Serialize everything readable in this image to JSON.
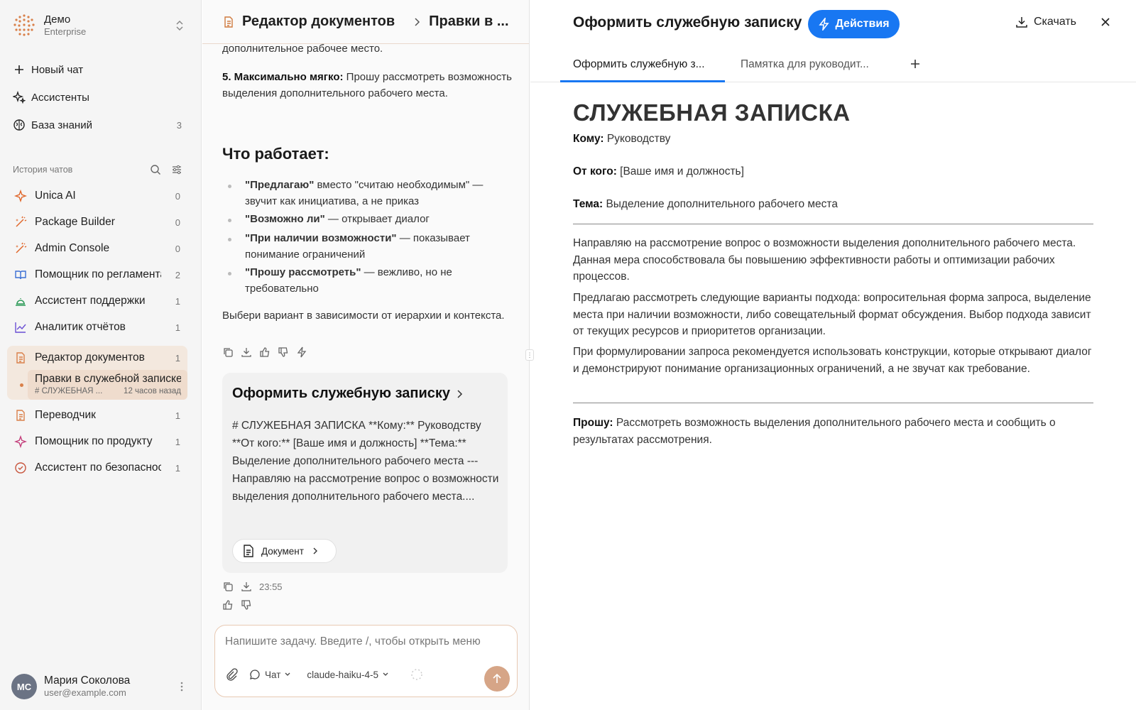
{
  "org": {
    "name": "Демо",
    "plan": "Enterprise"
  },
  "nav": [
    {
      "label": "Новый чат",
      "icon": "plus-icon",
      "count": ""
    },
    {
      "label": "Ассистенты",
      "icon": "sparkles-icon",
      "count": ""
    },
    {
      "label": "База знаний",
      "icon": "brain-icon",
      "count": "3"
    }
  ],
  "history": {
    "label": "История чатов",
    "chats": [
      {
        "label": "Unica AI",
        "count": "0",
        "icon": "sparkle-icon"
      },
      {
        "label": "Package Builder",
        "count": "0",
        "icon": "wand-icon"
      },
      {
        "label": "Admin Console",
        "count": "0",
        "icon": "wand-icon"
      },
      {
        "label": "Помощник по регламентам",
        "count": "2",
        "icon": "book-icon"
      },
      {
        "label": "Ассистент поддержки",
        "count": "1",
        "icon": "bell-icon"
      },
      {
        "label": "Аналитик отчётов",
        "count": "1",
        "icon": "chart-icon"
      },
      {
        "label": "Редактор документов",
        "count": "1",
        "icon": "document-icon"
      },
      {
        "label": "Переводчик",
        "count": "1",
        "icon": "document-icon"
      },
      {
        "label": "Помощник по продукту",
        "count": "1",
        "icon": "sparkle-icon"
      },
      {
        "label": "Ассистент по безопасности",
        "count": "1",
        "icon": "check-circle-icon"
      }
    ],
    "active_sub": {
      "title": "Правки в служебной записке",
      "tag": "# СЛУЖЕБНАЯ ...",
      "time": "12 часов назад"
    }
  },
  "user": {
    "initials": "МС",
    "name": "Мария Соколова",
    "email": "user@example.com"
  },
  "middle": {
    "breadcrumb1": "Редактор документов",
    "breadcrumb2": "Правки в ...",
    "msg_top": "дополнительное рабочее место.",
    "item5_bold": "5. Максимально мягко:",
    "item5_text": " Прошу рассмотреть возможность выделения дополнительного рабочего места.",
    "heading": "Что работает:",
    "bullets": [
      {
        "bold": "\"Предлагаю\"",
        "text": " вместо \"считаю необходимым\" — звучит как инициатива, а не приказ"
      },
      {
        "bold": "\"Возможно ли\"",
        "text": " — открывает диалог"
      },
      {
        "bold": "\"При наличии возможности\"",
        "text": " — показывает понимание ограничений"
      },
      {
        "bold": "\"Прошу рассмотреть\"",
        "text": " — вежливо, но не требовательно"
      }
    ],
    "closing": "Выбери вариант в зависимости от иерархии и контекста.",
    "card": {
      "title": "Оформить служебную записку",
      "body": "# СЛУЖЕБНАЯ ЗАПИСКА **Кому:** Руководству **От кого:** [Ваше имя и должность] **Тема:** Выделение дополнительного рабочего места --- Направляю на рассмотрение вопрос о возможности выделения дополнительного рабочего места....",
      "doc_button": "Документ"
    },
    "time": "23:55",
    "composer": {
      "placeholder": "Напишите задачу. Введите /, чтобы открыть меню",
      "mode": "Чат",
      "model": "claude-haiku-4-5"
    }
  },
  "panel": {
    "title": "Оформить служебную записку",
    "actions": "Действия",
    "download": "Скачать",
    "tabs": [
      "Оформить служебную з...",
      "Памятка для руководит..."
    ],
    "doc": {
      "heading": "СЛУЖЕБНАЯ ЗАПИСКА",
      "to_label": "Кому:",
      "to": " Руководству",
      "from_label": "От кого:",
      "from": " [Ваше имя и должность]",
      "subject_label": "Тема:",
      "subject": " Выделение дополнительного рабочего места",
      "p1": "Направляю на рассмотрение вопрос о возможности выделения дополнительного рабочего места. Данная мера способствовала бы повышению эффективности работы и оптимизации рабочих процессов.",
      "p2": "Предлагаю рассмотреть следующие варианты подхода: вопросительная форма запроса, выделение места при наличии возможности, либо совещательный формат обсуждения. Выбор подхода зависит от текущих ресурсов и приоритетов организации.",
      "p3": "При формулировании запроса рекомендуется использовать конструкции, которые открывают диалог и демонстрируют понимание организационных ограничений, а не звучат как требование.",
      "req_label": "Прошу:",
      "req": " Рассмотреть возможность выделения дополнительного рабочего места и сообщить о результатах рассмотрения."
    }
  },
  "colors": {
    "accent": "#1877f2",
    "brand": "#d9804a",
    "active_bg": "#f3e8de"
  }
}
